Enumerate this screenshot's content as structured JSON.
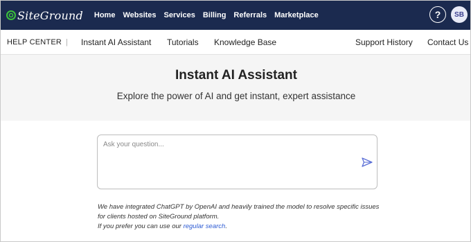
{
  "brand": {
    "name": "SiteGround",
    "logo_icon": "siteground-swirl-icon",
    "accent_color": "#3cc13b",
    "header_bg": "#1b2a4f"
  },
  "topnav": {
    "items": [
      "Home",
      "Websites",
      "Services",
      "Billing",
      "Referrals",
      "Marketplace"
    ]
  },
  "header_right": {
    "help_label": "?",
    "avatar_initials": "SB"
  },
  "subnav": {
    "section": "HELP CENTER",
    "separator": "|",
    "left_items": [
      "Instant AI Assistant",
      "Tutorials",
      "Knowledge Base"
    ],
    "right_items": [
      "Support History",
      "Contact Us"
    ]
  },
  "hero": {
    "title": "Instant AI Assistant",
    "subtitle": "Explore the power of AI and get instant, expert assistance"
  },
  "question": {
    "placeholder": "Ask your question...",
    "value": "",
    "send_icon": "send-arrow-icon"
  },
  "note": {
    "line1": "We have integrated ChatGPT by OpenAI and heavily trained the model to resolve specific issues for clients hosted on SiteGround platform.",
    "line2_prefix": "If you prefer you can use our ",
    "link_text": "regular search",
    "line2_suffix": "."
  }
}
